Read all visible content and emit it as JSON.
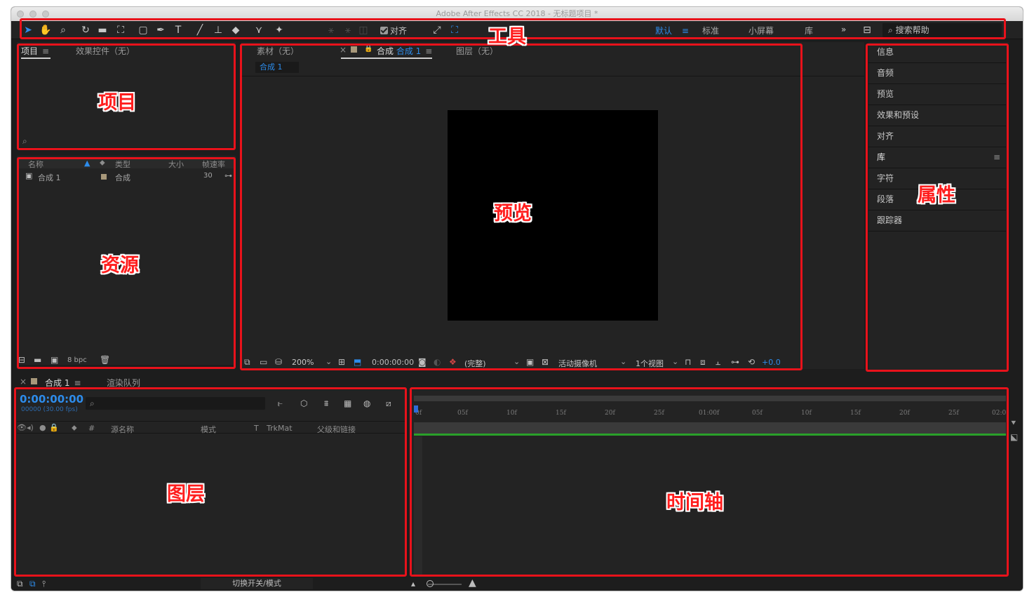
{
  "window": {
    "title": "Adobe After Effects CC 2018 - 无标题项目 *"
  },
  "toolbar": {
    "align_label": "对齐",
    "workspaces": [
      "默认",
      "标准",
      "小屏幕",
      "库"
    ],
    "more": "»",
    "search_label": "搜索帮助"
  },
  "project": {
    "tabs": [
      {
        "label": "项目"
      },
      {
        "label": "效果控件（无）"
      }
    ],
    "columns": [
      "名称",
      "类型",
      "大小",
      "帧速率"
    ],
    "items": [
      {
        "name": "合成 1",
        "type": "合成",
        "fps": "30"
      }
    ],
    "bpc": "8 bpc"
  },
  "viewer": {
    "tabs": [
      {
        "label": "素材（无）"
      },
      {
        "label_prefix": "合成",
        "label_active": "合成 1"
      },
      {
        "label": "图层（无）"
      }
    ],
    "breadcrumb": "合成 1",
    "zoom": "200%",
    "timecode": "0:00:00:00",
    "resolution": "(完整)",
    "camera": "活动摄像机",
    "views": "1个视图",
    "exposure": "+0.0"
  },
  "properties": {
    "items": [
      "信息",
      "音频",
      "预览",
      "效果和预设",
      "对齐",
      "库",
      "字符",
      "段落",
      "跟踪器"
    ]
  },
  "timeline": {
    "tabs": [
      {
        "label": "合成 1"
      },
      {
        "label": "渲染队列"
      }
    ],
    "timecode": "0:00:00:00",
    "frame_info": "00000 (30.00 fps)",
    "columns": [
      "#",
      "源名称",
      "模式",
      "T",
      "TrkMat",
      "父级和链接"
    ],
    "ruler": [
      "0f",
      "05f",
      "10f",
      "15f",
      "20f",
      "25f",
      "01:00f",
      "05f",
      "10f",
      "15f",
      "20f",
      "25f",
      "02:0"
    ],
    "footer_toggle": "切换开关/模式"
  },
  "annotations": {
    "tools": "工具",
    "project": "项目",
    "assets": "资源",
    "preview": "预览",
    "properties": "属性",
    "layers": "图层",
    "timeline": "时间轴"
  },
  "colors": {
    "accent": "#2d8ceb",
    "annotation": "#e8121b",
    "work_area": "#2aa02a"
  }
}
